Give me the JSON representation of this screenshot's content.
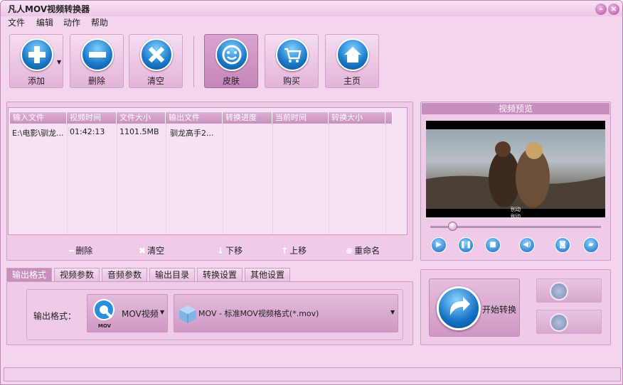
{
  "window": {
    "title": "凡人MOV视频转换器"
  },
  "menu": [
    "文件",
    "编辑",
    "动作",
    "帮助"
  ],
  "toolbar": {
    "add": "添加",
    "delete": "删除",
    "clear": "清空",
    "skin": "皮肤",
    "buy": "购买",
    "home": "主页"
  },
  "file_list": {
    "columns": [
      "输入文件",
      "视频时间",
      "文件大小",
      "输出文件",
      "转换进度",
      "当前时间",
      "转换大小"
    ],
    "rows": [
      {
        "input": "E:\\电影\\驯龙...",
        "duration": "01:42:13",
        "size": "1101.5MB",
        "output": "驯龙高手2...",
        "progress": "",
        "current_time": "",
        "converted_size": ""
      }
    ]
  },
  "list_actions": {
    "delete": "删除",
    "clear": "清空",
    "move_down": "下移",
    "move_up": "上移",
    "rename": "重命名"
  },
  "preview": {
    "title": "视频预览",
    "subtitle_line1": "别动",
    "subtitle_line2": "别动",
    "progress": 0.13
  },
  "tabs": [
    "输出格式",
    "视频参数",
    "音频参数",
    "输出目录",
    "转换设置",
    "其他设置"
  ],
  "output": {
    "label": "输出格式：",
    "format_name": "MOV视频",
    "format_badge": "MOV",
    "format_detail": "MOV - 标准MOV视频格式(*.mov)"
  },
  "convert": {
    "start": "开始转换"
  },
  "colors": {
    "window_bg": "#f3d6ee",
    "accent": "#c88fbe",
    "button_blue": "#1a78c8"
  }
}
